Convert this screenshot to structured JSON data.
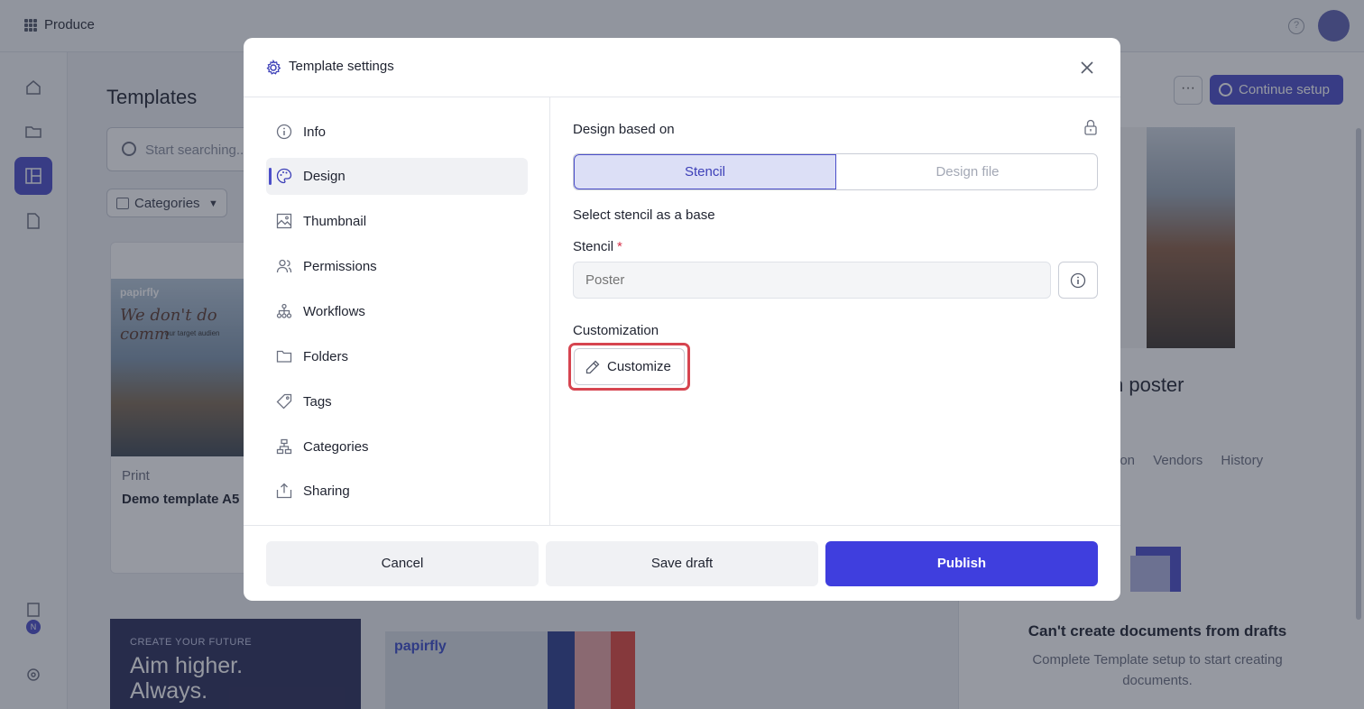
{
  "app": {
    "name": "Produce",
    "help_glyph": "?"
  },
  "background": {
    "page_title": "Templates",
    "search_placeholder": "Start searching...",
    "filter_chip": "Categories",
    "card1": {
      "brand": "papirfly",
      "headline": "We don't do comm",
      "subline": "our target audien",
      "type": "Print",
      "name": "Demo template A5"
    },
    "card2": {
      "kicker": "CREATE YOUR FUTURE",
      "headline_1": "Aim higher.",
      "headline_2": "Always."
    },
    "card3": {
      "brand": "papirfly"
    },
    "notification_badge": "N",
    "right_panel": {
      "more_glyph": "···",
      "continue_setup": "Continue setup",
      "title": "n poster",
      "tabs": [
        "ion",
        "Vendors",
        "History"
      ],
      "empty_title": "Can't create documents from drafts",
      "empty_text": "Complete Template setup to start creating documents."
    }
  },
  "modal": {
    "title": "Template settings",
    "nav": [
      {
        "label": "Info",
        "icon": "info-icon",
        "active": false
      },
      {
        "label": "Design",
        "icon": "palette-icon",
        "active": true
      },
      {
        "label": "Thumbnail",
        "icon": "image-icon",
        "active": false
      },
      {
        "label": "Permissions",
        "icon": "users-icon",
        "active": false
      },
      {
        "label": "Workflows",
        "icon": "workflow-icon",
        "active": false
      },
      {
        "label": "Folders",
        "icon": "folder-icon",
        "active": false
      },
      {
        "label": "Tags",
        "icon": "tag-icon",
        "active": false
      },
      {
        "label": "Categories",
        "icon": "categories-icon",
        "active": false
      },
      {
        "label": "Sharing",
        "icon": "share-icon",
        "active": false
      }
    ],
    "design": {
      "based_on_label": "Design based on",
      "option_stencil": "Stencil",
      "option_design_file": "Design file",
      "select_hint": "Select stencil as a base",
      "stencil_label": "Stencil",
      "required_mark": "*",
      "stencil_placeholder": "Poster",
      "customization_label": "Customization",
      "customize_button": "Customize"
    },
    "footer": {
      "cancel": "Cancel",
      "save_draft": "Save draft",
      "publish": "Publish"
    }
  },
  "colors": {
    "accent": "#4b4ec9",
    "publish": "#3f3ede",
    "highlight": "#d64550"
  }
}
